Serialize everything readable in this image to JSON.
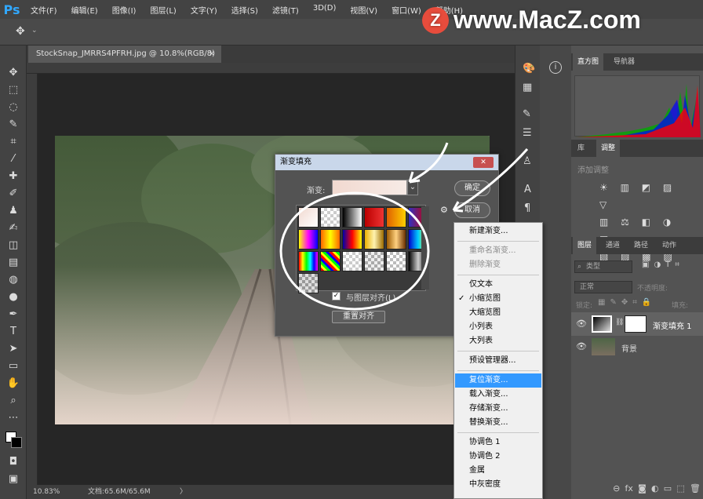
{
  "menubar": {
    "logo": "Ps",
    "items": [
      "文件(F)",
      "编辑(E)",
      "图像(I)",
      "图层(L)",
      "文字(Y)",
      "选择(S)",
      "滤镜(T)",
      "3D(D)",
      "视图(V)",
      "窗口(W)",
      "帮助(H)"
    ]
  },
  "document": {
    "tab_title": "StockSnap_JMRRS4PFRH.jpg @ 10.8%(RGB/8)",
    "tab_close": "×"
  },
  "status": {
    "zoom": "10.83%",
    "doc_size": "文档:65.6M/65.6M",
    "arrow": "〉"
  },
  "watermark": {
    "logo_letter": "Z",
    "text": "www.MacZ.com"
  },
  "dialog": {
    "title": "渐变填充",
    "close": "✕",
    "gradient_label": "渐变:",
    "ok": "确定",
    "cancel": "取消",
    "align_label": "与图层对齐(L)",
    "reset_align": "重置对齐"
  },
  "gradient_swatches": [
    "linear-gradient(135deg,#f1d9d0,#fff)",
    "repeating-conic-gradient(#ccc 0 25%,#fff 0 50%) 0 0/8px 8px",
    "linear-gradient(90deg,#000,#fff)",
    "linear-gradient(90deg,#b00,#e33)",
    "linear-gradient(90deg,#e06000,#ffd000)",
    "linear-gradient(90deg,#3030c0,#c00)",
    "linear-gradient(90deg,#ff0,#ff00ff,#00f)",
    "linear-gradient(90deg,#f60,#ff0,#f60)",
    "linear-gradient(90deg,#00a,#f00,#ff0)",
    "linear-gradient(90deg,#e9b000,#fff3b0,#9c6b00)",
    "linear-gradient(90deg,#9c5a00,#ffd080,#6a3000)",
    "linear-gradient(90deg,#00c,#0cf,#ff0)",
    "linear-gradient(90deg,#f00,#ff0,#0f0,#0ff,#00f,#f0f)",
    "repeating-linear-gradient(45deg,#f00 0 3px,#ff0 3px 6px,#0f0 6px 9px,#00f 9px 12px)",
    "repeating-conic-gradient(#ccc 0 25%,#fff 0 50%) 0 0/8px 8px",
    "repeating-conic-gradient(#aaa 0 25%,#eee 0 50%) 0 0/8px 8px",
    "repeating-conic-gradient(#bbb 0 25%,#fff 0 50%) 0 0/8px 8px",
    "linear-gradient(90deg,#000,#ccc,#000)",
    "repeating-conic-gradient(#999 0 25%,#ddd 0 50%) 0 0/8px 8px"
  ],
  "context_menu": {
    "items": [
      {
        "label": "新建渐变...",
        "state": "normal"
      },
      {
        "label": "重命名渐变...",
        "state": "disabled"
      },
      {
        "label": "删除渐变",
        "state": "disabled"
      },
      {
        "label": "仅文本",
        "state": "normal"
      },
      {
        "label": "小缩览图",
        "state": "checked"
      },
      {
        "label": "大缩览图",
        "state": "normal"
      },
      {
        "label": "小列表",
        "state": "normal"
      },
      {
        "label": "大列表",
        "state": "normal"
      },
      {
        "label": "预设管理器...",
        "state": "normal"
      },
      {
        "label": "复位渐变...",
        "state": "highlighted"
      },
      {
        "label": "载入渐变...",
        "state": "normal"
      },
      {
        "label": "存储渐变...",
        "state": "normal"
      },
      {
        "label": "替换渐变...",
        "state": "normal"
      },
      {
        "label": "协调色 1",
        "state": "normal"
      },
      {
        "label": "协调色 2",
        "state": "normal"
      },
      {
        "label": "金属",
        "state": "normal"
      },
      {
        "label": "中灰密度",
        "state": "normal"
      }
    ],
    "check": "✓"
  },
  "right_panel": {
    "histogram_tabs": [
      "直方图",
      "导航器"
    ],
    "adjust_tabs": [
      "库",
      "调整"
    ],
    "adjust_hint": "添加调整",
    "layers_tabs": [
      "图层",
      "通道",
      "路径",
      "动作"
    ],
    "filter_label": "类型",
    "blend_mode": "正常",
    "opacity_label": "不透明度:",
    "lock_label": "锁定:",
    "fill_label": "填充:",
    "layers": [
      {
        "name": "渐变填充 1"
      },
      {
        "name": "背景"
      }
    ],
    "footer_icons": [
      "⊖",
      "fx",
      "◙",
      "◐",
      "▭",
      "⬚",
      "🗑"
    ]
  },
  "colors": {
    "accent": "#31a8ff",
    "highlight": "#3399ff"
  }
}
